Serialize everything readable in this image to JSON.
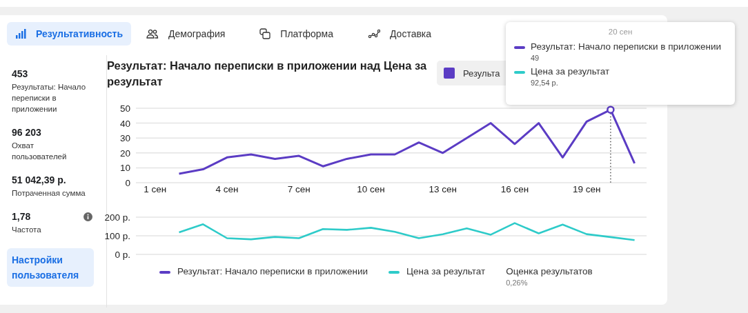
{
  "tabs": [
    {
      "label": "Результативность",
      "kind": "bars",
      "selected": true
    },
    {
      "label": "Демография",
      "kind": "people",
      "selected": false
    },
    {
      "label": "Платформа",
      "kind": "screens",
      "selected": false
    },
    {
      "label": "Доставка",
      "kind": "route",
      "selected": false
    }
  ],
  "metrics": [
    {
      "value": "453",
      "label": "Результаты: Начало переписки в приложении",
      "info": false
    },
    {
      "value": "96 203",
      "label": "Охват пользователей",
      "info": false
    },
    {
      "value": "51 042,39 р.",
      "label": "Потраченная сумма",
      "info": false
    },
    {
      "value": "1,78",
      "label": "Частота",
      "info": true
    }
  ],
  "settings_button": "Настройки пользователя",
  "chart_title": "Результат: Начало переписки в приложении над Цена за результат",
  "legend_chip": {
    "label": "Результа",
    "color": "#5b3cc4"
  },
  "charts": [
    {
      "chart_data": {
        "type": "line",
        "x": [
          2,
          3,
          4,
          5,
          6,
          7,
          8,
          9,
          10,
          11,
          12,
          13,
          14,
          15,
          16,
          17,
          18,
          19,
          20,
          21
        ],
        "series": [
          {
            "name": "Результат: Начало переписки в приложении",
            "color": "#5b3cc4",
            "values": [
              6,
              9,
              17,
              19,
              16,
              18,
              11,
              16,
              19,
              19,
              27,
              20,
              30,
              40,
              26,
              40,
              17,
              41,
              49,
              13
            ]
          }
        ],
        "xlim": [
          0.2,
          21.5
        ],
        "ylim": [
          0,
          50
        ],
        "yticks": [
          0,
          10,
          20,
          30,
          40,
          50
        ],
        "grid": true,
        "xticks": [
          {
            "value": 1,
            "label": "1 сен"
          },
          {
            "value": 4,
            "label": "4 сен"
          },
          {
            "value": 7,
            "label": "7 сен"
          },
          {
            "value": 10,
            "label": "10 сен"
          },
          {
            "value": 13,
            "label": "13 сен"
          },
          {
            "value": 16,
            "label": "16 сен"
          },
          {
            "value": 19,
            "label": "19 сен"
          }
        ],
        "ref_lines": [
          {
            "axis": "x",
            "value": 20
          }
        ]
      }
    },
    {
      "chart_data": {
        "type": "line",
        "x": [
          2,
          3,
          4,
          5,
          6,
          7,
          8,
          9,
          10,
          11,
          12,
          13,
          14,
          15,
          16,
          17,
          18,
          19,
          20,
          21
        ],
        "series": [
          {
            "name": "Цена за результат",
            "color": "#2ecbc9",
            "values": [
              119,
              162,
              87,
              81,
              94,
              87,
              136,
              132,
              143,
              121,
              87,
              108,
              140,
              106,
              168,
              113,
              160,
              109,
              93,
              77
            ]
          }
        ],
        "xlim": [
          0.2,
          21.5
        ],
        "ylim": [
          0,
          200
        ],
        "grid": true,
        "yticks": [
          {
            "value": 0,
            "label": "0 р."
          },
          {
            "value": 100,
            "label": "100 р."
          },
          {
            "value": 200,
            "label": "200 р."
          }
        ]
      }
    }
  ],
  "legend_extra": {
    "label": "Оценка результатов",
    "value": "0,26%"
  },
  "tooltip": {
    "date": "20 сен",
    "items": [
      {
        "label": "Результат: Начало переписки в приложении",
        "value": "49",
        "color": "#5b3cc4"
      },
      {
        "label": "Цена за результат",
        "value": "92,54 р.",
        "color": "#2ecbc9"
      }
    ]
  }
}
